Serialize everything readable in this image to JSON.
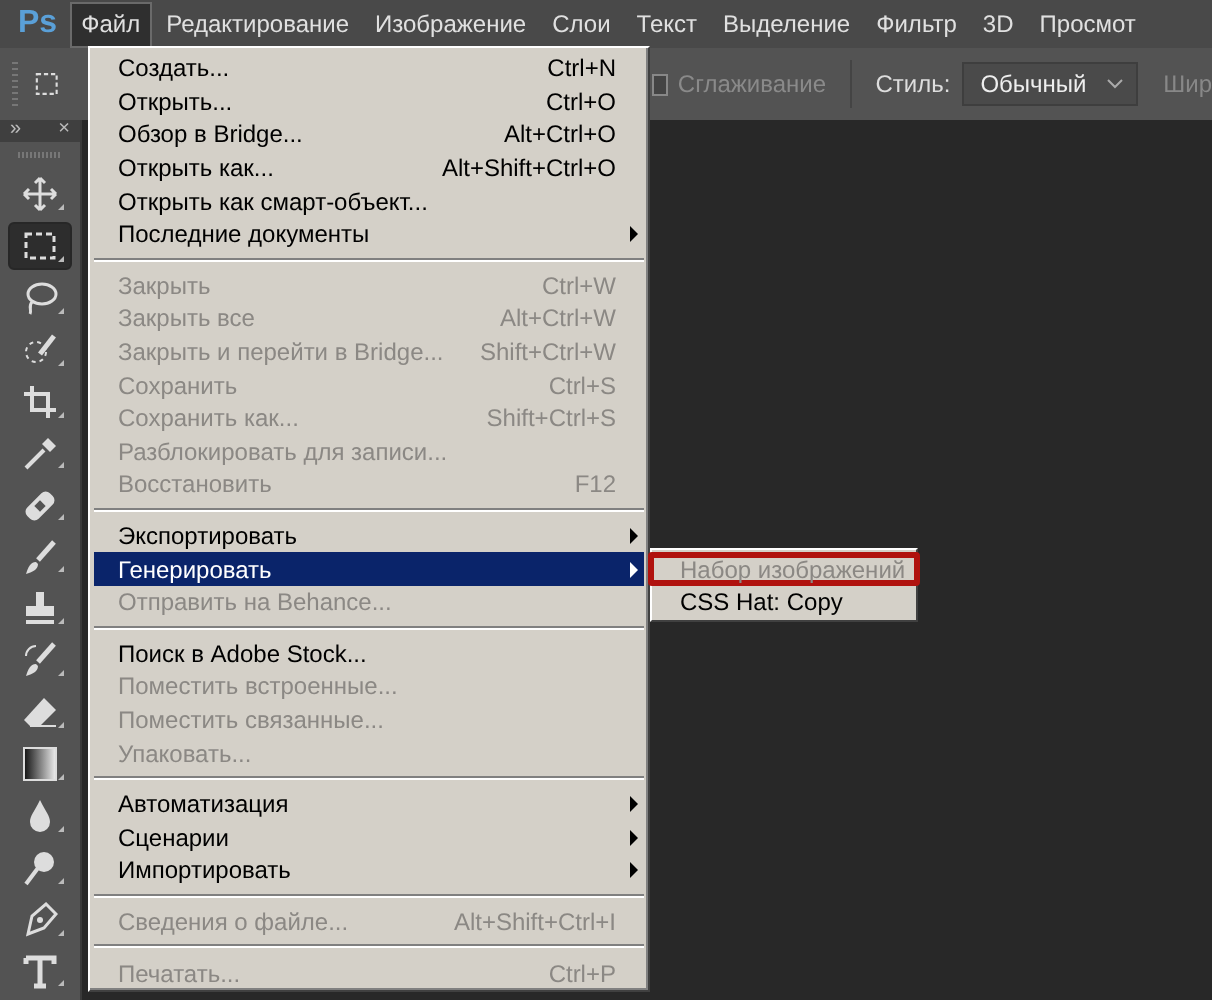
{
  "app": {
    "logo": "Ps"
  },
  "menubar": [
    {
      "label": "Файл",
      "selected": true
    },
    {
      "label": "Редактирование",
      "selected": false
    },
    {
      "label": "Изображение",
      "selected": false
    },
    {
      "label": "Слои",
      "selected": false
    },
    {
      "label": "Текст",
      "selected": false
    },
    {
      "label": "Выделение",
      "selected": false
    },
    {
      "label": "Фильтр",
      "selected": false
    },
    {
      "label": "3D",
      "selected": false
    },
    {
      "label": "Просмот",
      "selected": false
    }
  ],
  "options_bar": {
    "antialias": {
      "label": "Сглаживание",
      "checked": false,
      "disabled": true
    },
    "style": {
      "label": "Стиль:",
      "value": "Обычный"
    },
    "cut_label": "Шир"
  },
  "tools_header": {
    "collapse": "»",
    "close": "×"
  },
  "tools": [
    {
      "kind": "move",
      "selected": false
    },
    {
      "kind": "marquee",
      "selected": true
    },
    {
      "kind": "lasso",
      "selected": false
    },
    {
      "kind": "quickselect",
      "selected": false
    },
    {
      "kind": "crop",
      "selected": false
    },
    {
      "kind": "eyedropper",
      "selected": false
    },
    {
      "kind": "heal",
      "selected": false
    },
    {
      "kind": "brush",
      "selected": false
    },
    {
      "kind": "stamp",
      "selected": false
    },
    {
      "kind": "historybrush",
      "selected": false
    },
    {
      "kind": "eraser",
      "selected": false
    },
    {
      "kind": "gradient",
      "selected": false
    },
    {
      "kind": "blur",
      "selected": false
    },
    {
      "kind": "dodge",
      "selected": false
    },
    {
      "kind": "pen",
      "selected": false
    },
    {
      "kind": "type",
      "selected": false
    }
  ],
  "file_menu": [
    {
      "kind": "item",
      "label": "Создать...",
      "shortcut": "Ctrl+N",
      "disabled": false,
      "submenu": false,
      "selected": false
    },
    {
      "kind": "item",
      "label": "Открыть...",
      "shortcut": "Ctrl+O",
      "disabled": false,
      "submenu": false,
      "selected": false
    },
    {
      "kind": "item",
      "label": "Обзор в Bridge...",
      "shortcut": "Alt+Ctrl+O",
      "disabled": false,
      "submenu": false,
      "selected": false
    },
    {
      "kind": "item",
      "label": "Открыть как...",
      "shortcut": "Alt+Shift+Ctrl+O",
      "disabled": false,
      "submenu": false,
      "selected": false
    },
    {
      "kind": "item",
      "label": "Открыть как смарт-объект...",
      "disabled": false,
      "submenu": false,
      "selected": false
    },
    {
      "kind": "item",
      "label": "Последние документы",
      "disabled": false,
      "submenu": true,
      "selected": false
    },
    {
      "kind": "separator"
    },
    {
      "kind": "item",
      "label": "Закрыть",
      "shortcut": "Ctrl+W",
      "disabled": true,
      "submenu": false,
      "selected": false
    },
    {
      "kind": "item",
      "label": "Закрыть все",
      "shortcut": "Alt+Ctrl+W",
      "disabled": true,
      "submenu": false,
      "selected": false
    },
    {
      "kind": "item",
      "label": "Закрыть и перейти в Bridge...",
      "shortcut": "Shift+Ctrl+W",
      "disabled": true,
      "submenu": false,
      "selected": false
    },
    {
      "kind": "item",
      "label": "Сохранить",
      "shortcut": "Ctrl+S",
      "disabled": true,
      "submenu": false,
      "selected": false
    },
    {
      "kind": "item",
      "label": "Сохранить как...",
      "shortcut": "Shift+Ctrl+S",
      "disabled": true,
      "submenu": false,
      "selected": false
    },
    {
      "kind": "item",
      "label": "Разблокировать для записи...",
      "disabled": true,
      "submenu": false,
      "selected": false
    },
    {
      "kind": "item",
      "label": "Восстановить",
      "shortcut": "F12",
      "disabled": true,
      "submenu": false,
      "selected": false
    },
    {
      "kind": "separator"
    },
    {
      "kind": "item",
      "label": "Экспортировать",
      "disabled": false,
      "submenu": true,
      "selected": false
    },
    {
      "kind": "item",
      "label": "Генерировать",
      "disabled": false,
      "submenu": true,
      "selected": true,
      "children": [
        {
          "label": "Набор изображений",
          "disabled": true,
          "outlined": true
        },
        {
          "label": "CSS Hat: Copy",
          "disabled": false,
          "outlined": false
        }
      ]
    },
    {
      "kind": "item",
      "label": "Отправить на Behance...",
      "disabled": true,
      "submenu": false,
      "selected": false
    },
    {
      "kind": "separator"
    },
    {
      "kind": "item",
      "label": "Поиск в Adobe Stock...",
      "disabled": false,
      "submenu": false,
      "selected": false
    },
    {
      "kind": "item",
      "label": "Поместить встроенные...",
      "disabled": true,
      "submenu": false,
      "selected": false
    },
    {
      "kind": "item",
      "label": "Поместить связанные...",
      "disabled": true,
      "submenu": false,
      "selected": false
    },
    {
      "kind": "item",
      "label": "Упаковать...",
      "disabled": true,
      "submenu": false,
      "selected": false
    },
    {
      "kind": "separator"
    },
    {
      "kind": "item",
      "label": "Автоматизация",
      "disabled": false,
      "submenu": true,
      "selected": false
    },
    {
      "kind": "item",
      "label": "Сценарии",
      "disabled": false,
      "submenu": true,
      "selected": false
    },
    {
      "kind": "item",
      "label": "Импортировать",
      "disabled": false,
      "submenu": true,
      "selected": false
    },
    {
      "kind": "separator"
    },
    {
      "kind": "item",
      "label": "Сведения о файле...",
      "shortcut": "Alt+Shift+Ctrl+I",
      "disabled": true,
      "submenu": false,
      "selected": false
    },
    {
      "kind": "separator"
    },
    {
      "kind": "item",
      "label": "Печатать...",
      "shortcut": "Ctrl+P",
      "disabled": true,
      "submenu": false,
      "selected": false
    }
  ]
}
